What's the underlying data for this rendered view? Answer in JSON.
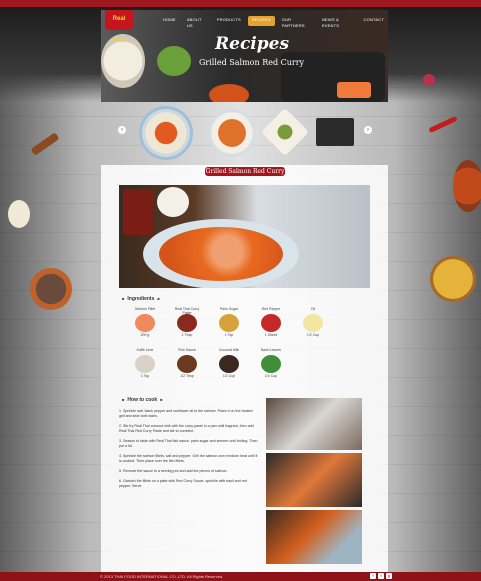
{
  "brand": {
    "logo_text": "Real THAI"
  },
  "nav": [
    {
      "label": "HOME"
    },
    {
      "label": "ABOUT US"
    },
    {
      "label": "PRODUCTS"
    },
    {
      "label": "RECIPES",
      "active": true
    },
    {
      "label": "OUR PARTNERS"
    },
    {
      "label": "NEWS & EVENTS"
    },
    {
      "label": "CONTACT"
    }
  ],
  "banner": {
    "title": "Recipes",
    "subtitle": "Grilled Salmon Red Curry"
  },
  "carousel": {
    "prev_icon": "‹",
    "next_icon": "›"
  },
  "recipe": {
    "name": "Grilled Salmon Red Curry",
    "ingredients_heading": "Ingredients",
    "how_heading": "How to cook",
    "ingredients": [
      {
        "name": "Salmon Fillet",
        "amount": "200 g",
        "color": "#f08a5d"
      },
      {
        "name": "Real Thai Curry Paste",
        "amount": "1 Tbsp",
        "color": "#8a2a1c"
      },
      {
        "name": "Palm Sugar",
        "amount": "1 Tsp",
        "color": "#d8a23a"
      },
      {
        "name": "Red Pepper",
        "amount": "1 Sliced",
        "color": "#c62828"
      },
      {
        "name": "Oil",
        "amount": "1/2 Cup",
        "color": "#f3e6a1"
      },
      {
        "name": "Kaffir Lime",
        "amount": "1 Tsp",
        "color": "#d9d2c4"
      },
      {
        "name": "Fish Sauce",
        "amount": "1/2 Tbsp",
        "color": "#6b3a1e"
      },
      {
        "name": "Coconut Milk",
        "amount": "1/2 Cup",
        "color": "#3a2a20"
      },
      {
        "name": "Basil Leaves",
        "amount": "1/4 Cup",
        "color": "#3e8e3a"
      }
    ],
    "steps": [
      "1. Sprinkle salt, black pepper and sunflower oil to the salmon. Place it on the heated grill and sear both sides.",
      "2. Stir fry Real Thai coconut milk with the curry paste in a pan until fragrant, then add Real Thai Red Curry Paste and stir to combine.",
      "3. Season to taste with Real Thai fish sauce, palm sugar and simmer until boiling. Then put a lid.",
      "4. Sprinkle the salmon fillets, salt and pepper. Grill the salmon over medium heat until it is cooked. Then place over the fish fillets.",
      "5. Remove the sauce to a serving pot and add the pieces of salmon.",
      "6. Garnish the fillets on a plate with Red Curry Sauce, sprinkle with basil and red pepper. Serve."
    ]
  },
  "footer": {
    "copyright": "© 2013 THAI FOOD INTERNATIONAL CO.,LTD. All Rights Reserved.",
    "social": [
      "f",
      "t",
      "g"
    ]
  }
}
